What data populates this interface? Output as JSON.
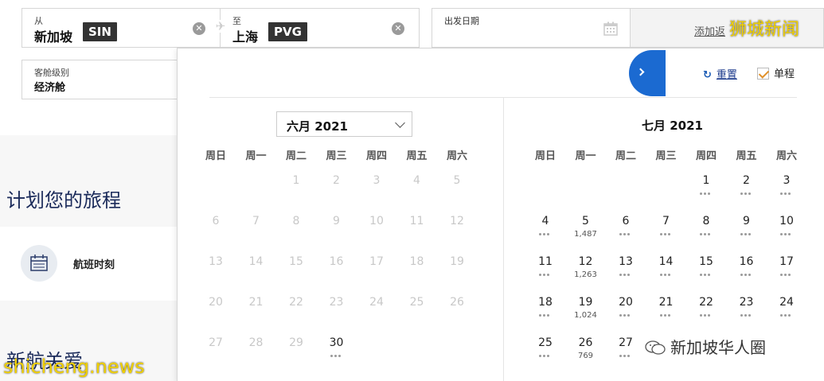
{
  "search": {
    "from": {
      "label": "从",
      "city": "新加坡",
      "code": "SIN"
    },
    "to": {
      "label": "至",
      "city": "上海",
      "code": "PVG"
    },
    "depart_label": "出发日期",
    "return_link": "添加返",
    "cabin": {
      "label": "客舱级别",
      "value": "经济舱"
    }
  },
  "left": {
    "plan_title": "计划您的旅程",
    "schedule_label": "航班时刻",
    "care_title": "新航关爱"
  },
  "calendar": {
    "reset_label": "重置",
    "oneway_label": "单程",
    "month1": {
      "select_label": "六月 2021",
      "weekdays": [
        "周日",
        "周一",
        "周二",
        "周三",
        "周四",
        "周五",
        "周六"
      ],
      "disabled": [
        "1",
        "2",
        "3",
        "4",
        "5",
        "6",
        "7",
        "8",
        "9",
        "10",
        "11",
        "12",
        "13",
        "14",
        "15",
        "16",
        "17",
        "18",
        "19",
        "20",
        "21",
        "22",
        "23",
        "24",
        "25",
        "26",
        "27",
        "28",
        "29"
      ],
      "active": [
        "30"
      ]
    },
    "month2": {
      "title": "七月 2021",
      "weekdays": [
        "周日",
        "周一",
        "周二",
        "周三",
        "周四",
        "周五",
        "周六"
      ],
      "days": [
        "1",
        "2",
        "3",
        "4",
        "5",
        "6",
        "7",
        "8",
        "9",
        "10",
        "11",
        "12",
        "13",
        "14",
        "15",
        "16",
        "17",
        "18",
        "19",
        "20",
        "21",
        "22",
        "23",
        "24",
        "25",
        "26",
        "27"
      ],
      "prices": {
        "5": "1,487",
        "12": "1,263",
        "19": "1,024",
        "26": "769"
      }
    }
  },
  "watermarks": {
    "top": "狮城新闻",
    "bottom": "shicheng.news",
    "wechat": "新加坡华人圈"
  }
}
